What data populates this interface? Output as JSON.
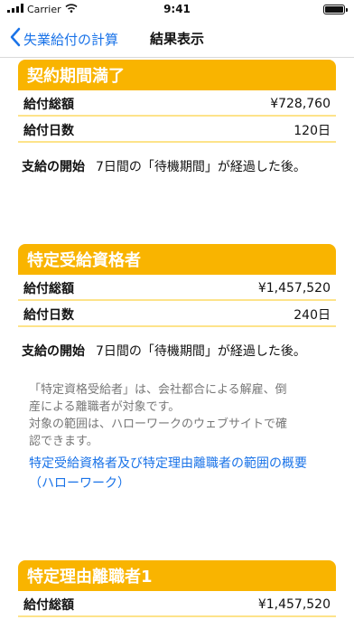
{
  "status": {
    "carrier": "Carrier",
    "time": "9:41",
    "battery_level": 1.0
  },
  "nav": {
    "back_label": "失業給付の計算",
    "title": "結果表示"
  },
  "sections": [
    {
      "title": "契約期間満了",
      "total_label": "給付総額",
      "total_value": "¥728,760",
      "days_label": "給付日数",
      "days_value": "120日",
      "start_label": "支給の開始",
      "start_value": "7日間の「待機期間」が経過した後。"
    },
    {
      "title": "特定受給資格者",
      "total_label": "給付総額",
      "total_value": "¥1,457,520",
      "days_label": "給付日数",
      "days_value": "240日",
      "start_label": "支給の開始",
      "start_value": "7日間の「待機期間」が経過した後。",
      "note_line1": "「特定資格受給者」は、会社都合による解雇、倒",
      "note_line2": "産による離職者が対象です。",
      "note_line3": "対象の範囲は、ハローワークのウェブサイトで確",
      "note_line4": "認できます。",
      "link_line1": "特定受給資格者及び特定理由離職者の範囲の概要",
      "link_line2": "（ハローワーク）"
    },
    {
      "title": "特定理由離職者1",
      "total_label": "給付総額",
      "total_value": "¥1,457,520"
    }
  ],
  "colors": {
    "accent": "#f9b400",
    "underline": "#fde38a",
    "link": "#1a73e8"
  }
}
